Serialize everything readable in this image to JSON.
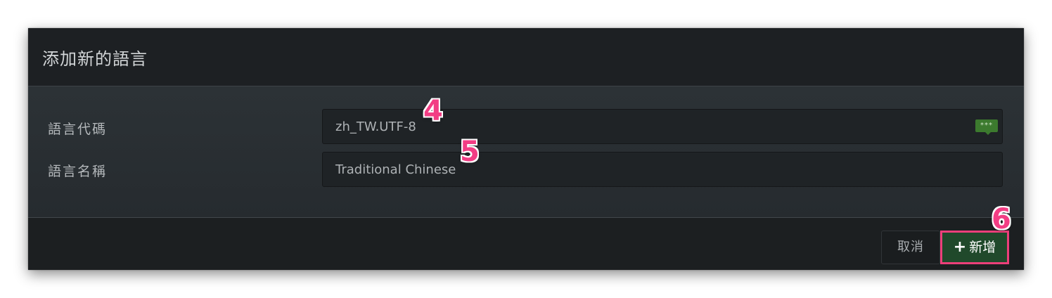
{
  "dialog": {
    "title": "添加新的語言",
    "fields": [
      {
        "label": "語言代碼",
        "value": "zh_TW.UTF-8",
        "icon": "keyboard-icon",
        "icon_text": "***"
      },
      {
        "label": "語言名稱",
        "value": "Traditional Chinese"
      }
    ],
    "buttons": {
      "cancel_label": "取消",
      "add_icon": "+",
      "add_label": "新增"
    }
  },
  "annotations": {
    "step4": "4",
    "step5": "5",
    "step6": "6"
  },
  "colors": {
    "dialog_bg": "#1c1f21",
    "body_bg": "#2c3236",
    "add_button_bg": "#20492b",
    "highlight": "#ec3f7a",
    "badge": "#f23d84"
  }
}
